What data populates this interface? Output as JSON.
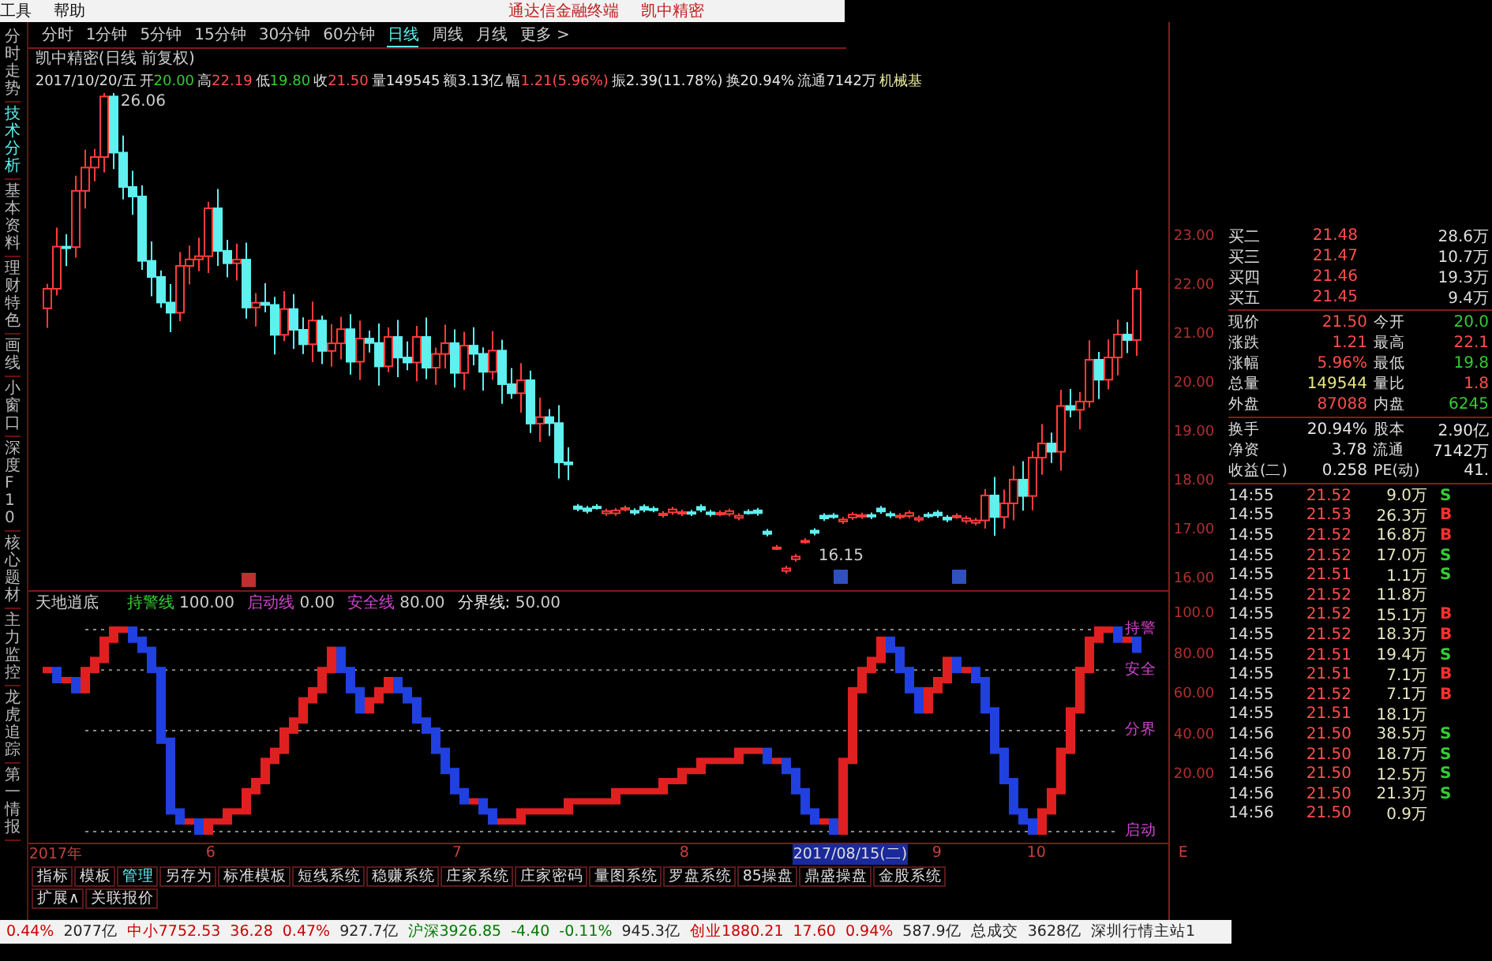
{
  "menubar": {
    "items": [
      "工具",
      "帮助"
    ],
    "app_title": "通达信金融终端",
    "stock_name": "凯中精密"
  },
  "side_tabs": [
    {
      "label": "分时走势",
      "selected": false
    },
    {
      "label": "技术分析",
      "selected": true
    },
    {
      "label": "基本资料",
      "selected": false
    },
    {
      "label": "理财特色",
      "selected": false
    },
    {
      "label": "画线",
      "selected": false
    },
    {
      "label": "小窗口",
      "selected": false
    },
    {
      "label": "深度F10",
      "selected": false
    },
    {
      "label": "核心题材",
      "selected": false
    },
    {
      "label": "主力监控",
      "selected": false
    },
    {
      "label": "龙虎追踪",
      "selected": false
    },
    {
      "label": "第一情报",
      "selected": false
    }
  ],
  "period_tabs": [
    {
      "label": "分时",
      "selected": false
    },
    {
      "label": "1分钟",
      "selected": false
    },
    {
      "label": "5分钟",
      "selected": false
    },
    {
      "label": "15分钟",
      "selected": false
    },
    {
      "label": "30分钟",
      "selected": false
    },
    {
      "label": "60分钟",
      "selected": false
    },
    {
      "label": "日线",
      "selected": true
    },
    {
      "label": "周线",
      "selected": false
    },
    {
      "label": "月线",
      "selected": false
    },
    {
      "label": "更多 >",
      "selected": false
    }
  ],
  "chart_title": "凯中精密(日线 前复权)",
  "quote_line": {
    "date": "2017/10/20/五",
    "items": [
      {
        "label": "开",
        "value": "20.00",
        "color": "#33cc33"
      },
      {
        "label": "高",
        "value": "22.19",
        "color": "#ff4d4d"
      },
      {
        "label": "低",
        "value": "19.80",
        "color": "#33cc33"
      },
      {
        "label": "收",
        "value": "21.50",
        "color": "#ff4d4d"
      },
      {
        "label": "量",
        "value": "149545",
        "color": "#e6e6e6"
      },
      {
        "label": "额",
        "value": "3.13亿",
        "color": "#e6e6e6"
      },
      {
        "label": "幅",
        "value": "1.21(5.96%)",
        "color": "#ff4d4d"
      },
      {
        "label": "振",
        "value": "2.39(11.78%)",
        "color": "#e6e6e6"
      },
      {
        "label": "换",
        "value": "20.94%",
        "color": "#e6e6e6"
      },
      {
        "label": "流通",
        "value": "7142万",
        "color": "#e6e6e6"
      },
      {
        "label": "机械基",
        "color": "#e6e6a0"
      }
    ]
  },
  "candle_chart": {
    "high_label": "26.06",
    "low_label": "16.15"
  },
  "price_axis": [
    "23.00",
    "22.00",
    "21.00",
    "20.00",
    "19.00",
    "18.00",
    "17.00",
    "16.00"
  ],
  "indicator": {
    "name": "天地逍底",
    "lines": [
      {
        "label": "持警线",
        "value": "100.00",
        "color": "#33cc33"
      },
      {
        "label": "启动线",
        "value": "0.00",
        "color": "#cc44cc"
      },
      {
        "label": "安全线",
        "value": "80.00",
        "color": "#cc44cc"
      },
      {
        "label": "分界线:",
        "value": "50.00",
        "color": "#e6e6e6"
      }
    ],
    "level_labels": [
      "持警",
      "安全",
      "分界",
      "启动"
    ]
  },
  "indicator_axis": [
    "100.0",
    "80.00",
    "60.00",
    "40.00",
    "20.00"
  ],
  "date_axis": [
    {
      "label": "2017年",
      "selected": false
    },
    {
      "label": "6",
      "selected": false
    },
    {
      "label": "7",
      "selected": false
    },
    {
      "label": "8",
      "selected": false
    },
    {
      "label": "2017/08/15(二)",
      "selected": true
    },
    {
      "label": "9",
      "selected": false
    },
    {
      "label": "10",
      "selected": false
    },
    {
      "label": "E",
      "selected": false
    }
  ],
  "bottom_tabs": [
    {
      "label": "指标",
      "selected": false
    },
    {
      "label": "模板",
      "selected": false
    },
    {
      "label": "管理",
      "selected": true
    },
    {
      "label": "另存为",
      "selected": false
    },
    {
      "label": "标准模板",
      "selected": false
    },
    {
      "label": "短线系统",
      "selected": false
    },
    {
      "label": "稳赚系统",
      "selected": false
    },
    {
      "label": "庄家系统",
      "selected": false
    },
    {
      "label": "庄家密码",
      "selected": false
    },
    {
      "label": "量图系统",
      "selected": false
    },
    {
      "label": "罗盘系统",
      "selected": false
    },
    {
      "label": "85操盘",
      "selected": false
    },
    {
      "label": "鼎盛操盘",
      "selected": false
    },
    {
      "label": "金股系统",
      "selected": false
    }
  ],
  "extra_tabs": [
    "扩展∧",
    "关联报价"
  ],
  "order_book": [
    {
      "label": "买二",
      "price": "21.48",
      "volume": "28.6万"
    },
    {
      "label": "买三",
      "price": "21.47",
      "volume": "10.7万"
    },
    {
      "label": "买四",
      "price": "21.46",
      "volume": "19.3万"
    },
    {
      "label": "买五",
      "price": "21.45",
      "volume": "9.4万"
    }
  ],
  "quote_grid": [
    {
      "cells": [
        {
          "label": "现价",
          "value": "21.50",
          "color": "#ff4d4d"
        },
        {
          "label": "今开",
          "value": "20.0",
          "color": "#33cc33"
        }
      ]
    },
    {
      "cells": [
        {
          "label": "涨跌",
          "value": "1.21",
          "color": "#ff4d4d"
        },
        {
          "label": "最高",
          "value": "22.1",
          "color": "#ff4d4d"
        }
      ]
    },
    {
      "cells": [
        {
          "label": "涨幅",
          "value": "5.96%",
          "color": "#ff4d4d"
        },
        {
          "label": "最低",
          "value": "19.8",
          "color": "#33cc33"
        }
      ]
    },
    {
      "cells": [
        {
          "label": "总量",
          "value": "149544",
          "color": "#e6e680"
        },
        {
          "label": "量比",
          "value": "1.8",
          "color": "#ff4d4d"
        }
      ]
    },
    {
      "cells": [
        {
          "label": "外盘",
          "value": "87088",
          "color": "#ff4d4d"
        },
        {
          "label": "内盘",
          "value": "6245",
          "color": "#33cc33"
        }
      ]
    },
    {
      "cells": [
        {
          "label": "换手",
          "value": "20.94%",
          "color": "#e6e6e6"
        },
        {
          "label": "股本",
          "value": "2.90亿",
          "color": "#e6e6e6"
        }
      ]
    },
    {
      "cells": [
        {
          "label": "净资",
          "value": "3.78",
          "color": "#e6e6e6"
        },
        {
          "label": "流通",
          "value": "7142万",
          "color": "#e6e6e6"
        }
      ]
    },
    {
      "cells": [
        {
          "label": "收益(二)",
          "value": "0.258",
          "color": "#e6e6e6"
        },
        {
          "label": "PE(动)",
          "value": "41.",
          "color": "#e6e6e6"
        }
      ]
    }
  ],
  "ticks": [
    {
      "time": "14:55",
      "price": "21.52",
      "volume": "9.0万",
      "side": "S",
      "kind": "sell"
    },
    {
      "time": "14:55",
      "price": "21.53",
      "volume": "26.3万",
      "side": "B",
      "kind": "buy"
    },
    {
      "time": "14:55",
      "price": "21.52",
      "volume": "16.8万",
      "side": "B",
      "kind": "buy"
    },
    {
      "time": "14:55",
      "price": "21.52",
      "volume": "17.0万",
      "side": "S",
      "kind": "sell"
    },
    {
      "time": "14:55",
      "price": "21.51",
      "volume": "1.1万",
      "side": "S",
      "kind": "sell"
    },
    {
      "time": "14:55",
      "price": "21.52",
      "volume": "11.8万"
    },
    {
      "time": "14:55",
      "price": "21.52",
      "volume": "15.1万",
      "side": "B",
      "kind": "buy"
    },
    {
      "time": "14:55",
      "price": "21.52",
      "volume": "18.3万",
      "side": "B",
      "kind": "buy"
    },
    {
      "time": "14:55",
      "price": "21.51",
      "volume": "19.4万",
      "side": "S",
      "kind": "sell"
    },
    {
      "time": "14:55",
      "price": "21.51",
      "volume": "7.1万",
      "side": "B",
      "kind": "buy"
    },
    {
      "time": "14:55",
      "price": "21.52",
      "volume": "7.1万",
      "side": "B",
      "kind": "buy"
    },
    {
      "time": "14:55",
      "price": "21.51",
      "volume": "18.1万"
    },
    {
      "time": "14:56",
      "price": "21.50",
      "volume": "38.5万",
      "side": "S",
      "kind": "sell"
    },
    {
      "time": "14:56",
      "price": "21.50",
      "volume": "18.7万",
      "side": "S",
      "kind": "sell"
    },
    {
      "time": "14:56",
      "price": "21.50",
      "volume": "12.5万",
      "side": "S",
      "kind": "sell"
    },
    {
      "time": "14:56",
      "price": "21.50",
      "volume": "21.3万",
      "side": "S",
      "kind": "sell"
    },
    {
      "time": "14:56",
      "price": "21.50",
      "volume": "0.9万"
    }
  ],
  "status_bar": [
    {
      "text": "0.44%",
      "color": "#cc0000"
    },
    {
      "text": "2077亿",
      "color": "#222222"
    },
    {
      "text": "中小7752.53",
      "color": "#cc0000"
    },
    {
      "text": "36.28",
      "color": "#cc0000"
    },
    {
      "text": "0.47%",
      "color": "#cc0000"
    },
    {
      "text": "927.7亿",
      "color": "#222222"
    },
    {
      "text": "沪深3926.85",
      "color": "#007a00"
    },
    {
      "text": "-4.40",
      "color": "#007a00"
    },
    {
      "text": "-0.11%",
      "color": "#007a00"
    },
    {
      "text": "945.3亿",
      "color": "#222222"
    },
    {
      "text": "创业1880.21",
      "color": "#cc0000"
    },
    {
      "text": "17.60",
      "color": "#cc0000"
    },
    {
      "text": "0.94%",
      "color": "#cc0000"
    },
    {
      "text": "587.9亿",
      "color": "#222222"
    },
    {
      "text": "总成交",
      "color": "#222222"
    },
    {
      "text": "3628亿",
      "color": "#222222"
    },
    {
      "text": "深圳行情主站1",
      "color": "#222222"
    }
  ]
}
